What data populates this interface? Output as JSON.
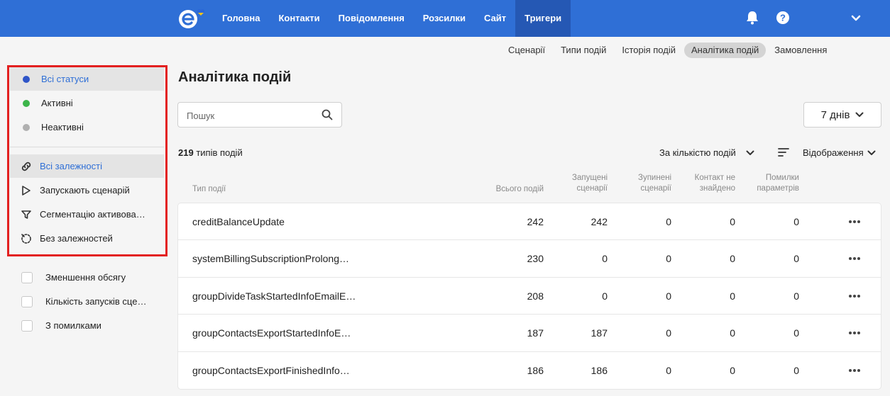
{
  "header": {
    "nav": [
      "Головна",
      "Контакти",
      "Повідомлення",
      "Розсилки",
      "Сайт",
      "Тригери"
    ],
    "active_nav": "Тригери",
    "icons": [
      "logo-icon",
      "bell-icon",
      "help-icon",
      "chevron-down-icon"
    ]
  },
  "subnav": {
    "items": [
      "Сценарії",
      "Типи подій",
      "Історія подій",
      "Аналітика подій",
      "Замовлення"
    ],
    "active": "Аналітика подій"
  },
  "sidebar": {
    "statuses": [
      {
        "label": "Всі статуси",
        "color": "#2f55c8"
      },
      {
        "label": "Активні",
        "color": "#3cb54a"
      },
      {
        "label": "Неактивні",
        "color": "#b0b0b0"
      }
    ],
    "dependencies": [
      {
        "label": "Всі залежності",
        "icon": "link-icon"
      },
      {
        "label": "Запускають сценарій",
        "icon": "play-icon"
      },
      {
        "label": "Сегментацію активова…",
        "icon": "funnel-icon"
      },
      {
        "label": "Без залежностей",
        "icon": "unlink-icon"
      }
    ],
    "checks": [
      {
        "label": "Зменшення обсягу"
      },
      {
        "label": "Кількість запусків сце…"
      },
      {
        "label": "З помилками"
      }
    ]
  },
  "main": {
    "title": "Аналітика подій",
    "search_placeholder": "Пошук",
    "period": "7 днів",
    "count_number": "219",
    "count_label": "типів подій",
    "sort_label": "За кількістю подій",
    "display_label": "Відображення"
  },
  "table": {
    "columns": {
      "type": "Тип події",
      "total": "Всього подій",
      "started_1": "Запущені",
      "started_2": "сценарії",
      "stopped_1": "Зупинені",
      "stopped_2": "сценарії",
      "notfound_1": "Контакт не",
      "notfound_2": "знайдено",
      "errors_1": "Помилки",
      "errors_2": "параметрів"
    },
    "rows": [
      {
        "name": "creditBalanceUpdate",
        "total": "242",
        "started": "242",
        "stopped": "0",
        "notfound": "0",
        "errors": "0"
      },
      {
        "name": "systemBillingSubscriptionProlong…",
        "total": "230",
        "started": "0",
        "stopped": "0",
        "notfound": "0",
        "errors": "0"
      },
      {
        "name": "groupDivideTaskStartedInfoEmailE…",
        "total": "208",
        "started": "0",
        "stopped": "0",
        "notfound": "0",
        "errors": "0"
      },
      {
        "name": "groupContactsExportStartedInfoE…",
        "total": "187",
        "started": "187",
        "stopped": "0",
        "notfound": "0",
        "errors": "0"
      },
      {
        "name": "groupContactsExportFinishedInfo…",
        "total": "186",
        "started": "186",
        "stopped": "0",
        "notfound": "0",
        "errors": "0"
      }
    ]
  }
}
